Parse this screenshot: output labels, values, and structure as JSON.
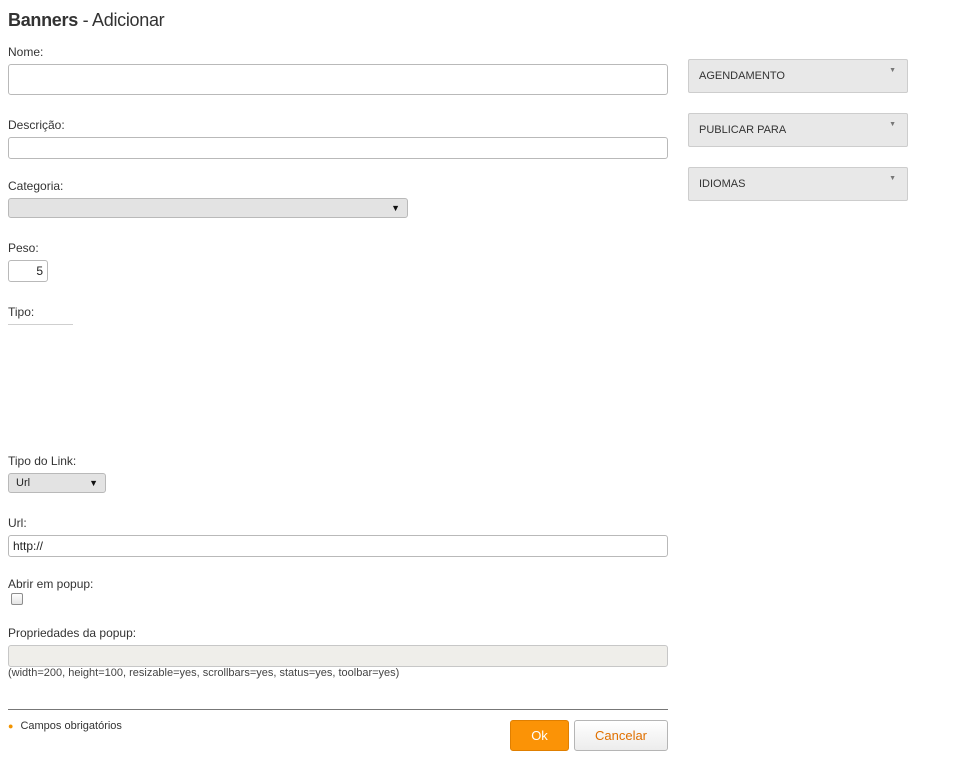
{
  "header": {
    "title_bold": "Banners",
    "title_rest": " - Adicionar"
  },
  "form": {
    "nome": {
      "label": "Nome:",
      "value": ""
    },
    "descricao": {
      "label": "Descrição:",
      "value": ""
    },
    "categoria": {
      "label": "Categoria:",
      "value": ""
    },
    "peso": {
      "label": "Peso:",
      "value": "5"
    },
    "tipo": {
      "label": "Tipo:"
    },
    "tipo_link": {
      "label": "Tipo do Link:",
      "value": "Url"
    },
    "url": {
      "label": "Url:",
      "value": "http://"
    },
    "abrir_popup": {
      "label": "Abrir em popup:",
      "checked": false
    },
    "popup_props": {
      "label": "Propriedades da popup:",
      "value": "",
      "hint": "(width=200, height=100, resizable=yes, scrollbars=yes, status=yes, toolbar=yes)"
    }
  },
  "footer": {
    "required_note": "Campos obrigatórios",
    "ok_label": "Ok",
    "cancel_label": "Cancelar"
  },
  "sidebar": {
    "panels": [
      "AGENDAMENTO",
      "PUBLICAR PARA",
      "IDIOMAS"
    ]
  },
  "colors": {
    "accent": "#fb9306",
    "panel_bg": "#e8e8e8",
    "required_icon": "#f29400"
  },
  "icons": {
    "select_arrow": "caret-down-icon",
    "panel_arrow": "caret-down-icon",
    "required": "required-icon"
  }
}
